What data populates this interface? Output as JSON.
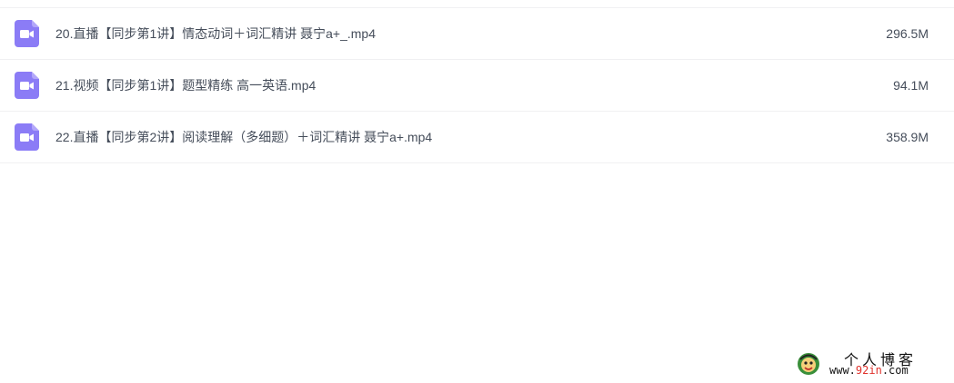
{
  "files": [
    {
      "name": "20.直播【同步第1讲】情态动词＋词汇精讲 聂宁a+_.mp4",
      "size": "296.5M",
      "icon": "video-file-icon"
    },
    {
      "name": "21.视频【同步第1讲】题型精练 高一英语.mp4",
      "size": "94.1M",
      "icon": "video-file-icon"
    },
    {
      "name": "22.直播【同步第2讲】阅读理解（多细题）＋词汇精讲 聂宁a+.mp4",
      "size": "358.9M",
      "icon": "video-file-icon"
    }
  ],
  "colors": {
    "icon_bg": "#8b7cf6",
    "text": "#454d5a",
    "divider": "#f0f0f2",
    "watermark_accent": "#e0312b"
  },
  "watermark": {
    "title": "个人博客",
    "url_prefix": "www.",
    "url_accent": "92in",
    "url_suffix": ".com"
  }
}
